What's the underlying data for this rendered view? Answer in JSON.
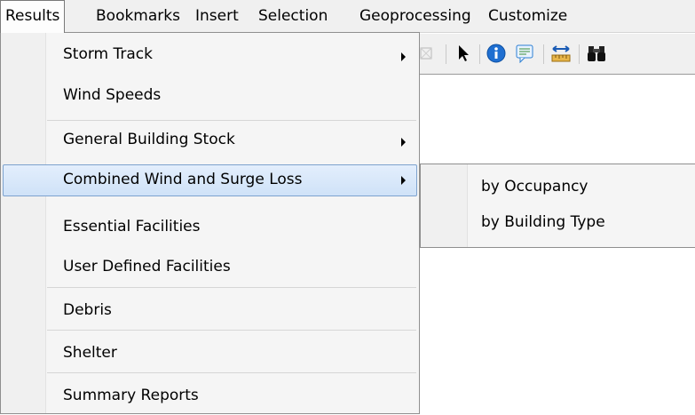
{
  "menubar": {
    "items": [
      {
        "label": "Results"
      },
      {
        "label": "Bookmarks"
      },
      {
        "label": "Insert"
      },
      {
        "label": "Selection"
      },
      {
        "label": "Geoprocessing"
      },
      {
        "label": "Customize"
      }
    ]
  },
  "toolbar": {
    "icons": [
      "full-extent-icon",
      "select-pointer-icon",
      "identify-icon",
      "html-popup-icon",
      "measure-icon",
      "find-icon"
    ]
  },
  "results_menu": {
    "items": [
      {
        "label": "Storm Track",
        "has_submenu": true
      },
      {
        "label": "Wind Speeds",
        "has_submenu": false
      },
      {
        "label": "General Building Stock",
        "has_submenu": true
      },
      {
        "label": "Combined Wind and Surge Loss",
        "has_submenu": true,
        "highlighted": true
      },
      {
        "label": "Essential Facilities",
        "has_submenu": false
      },
      {
        "label": "User Defined Facilities",
        "has_submenu": false
      },
      {
        "label": "Debris",
        "has_submenu": false
      },
      {
        "label": "Shelter",
        "has_submenu": false
      },
      {
        "label": "Summary Reports",
        "has_submenu": false
      }
    ]
  },
  "submenu": {
    "items": [
      {
        "label": "by Occupancy"
      },
      {
        "label": "by Building Type"
      }
    ]
  },
  "colors": {
    "highlight_border": "#7da2ce",
    "highlight_fill": "#cfe2f8",
    "identify_blue": "#1f6fd1"
  }
}
